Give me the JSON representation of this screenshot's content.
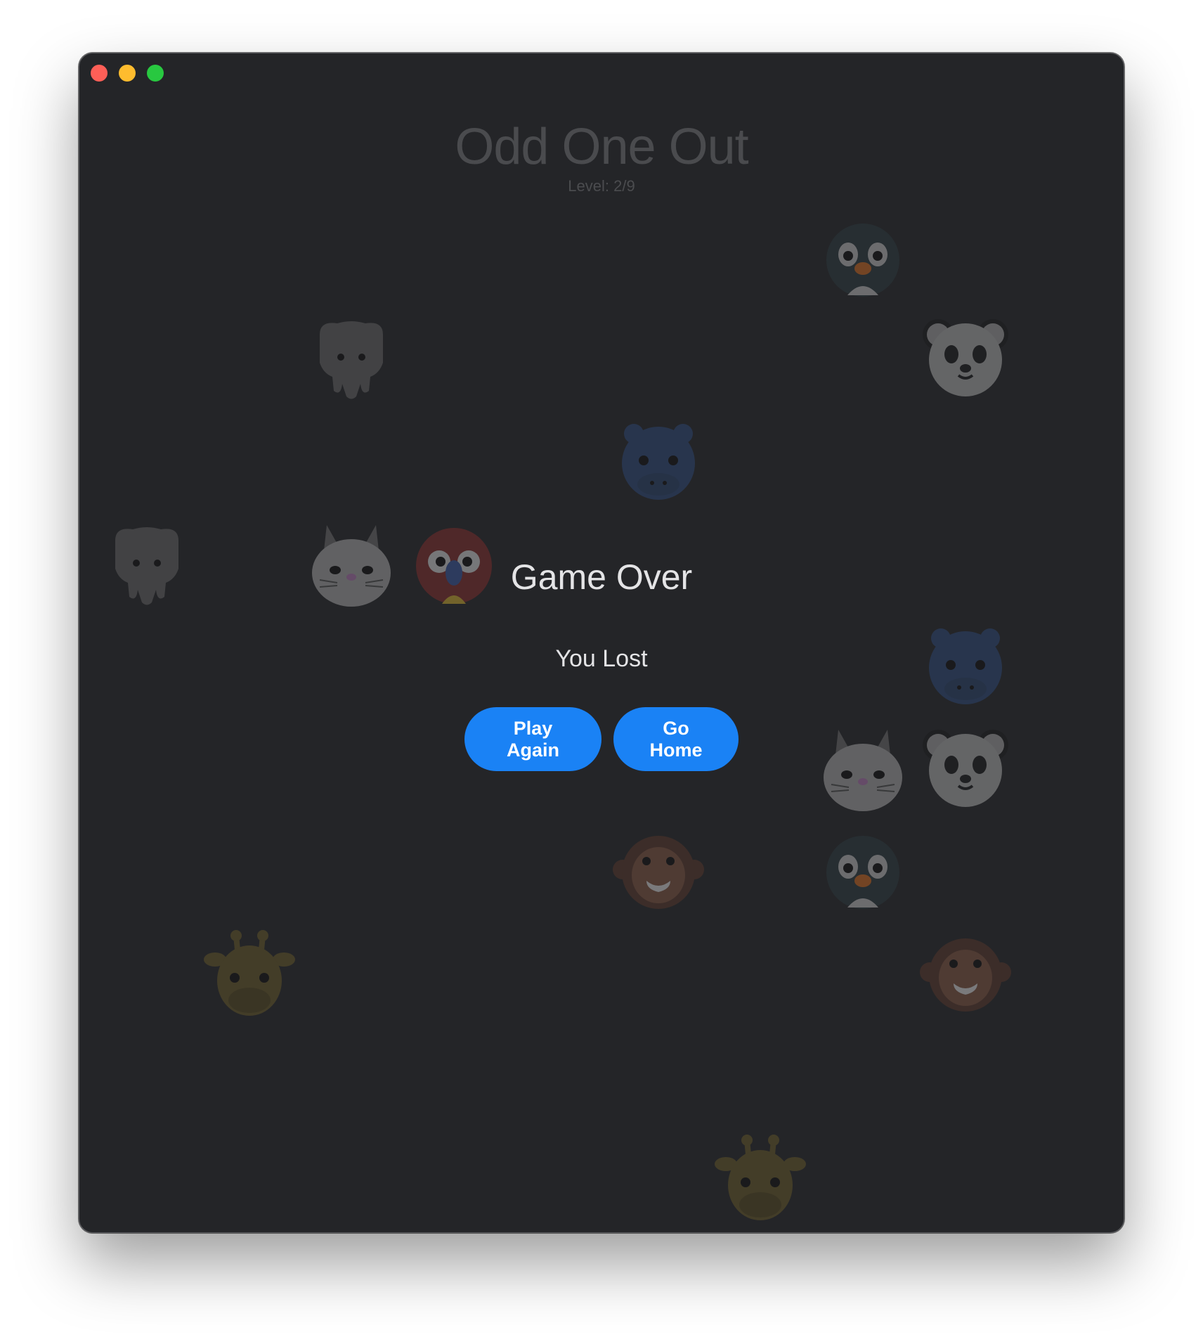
{
  "window": {
    "controls": [
      "close",
      "minimize",
      "maximize"
    ]
  },
  "header": {
    "title": "Odd One Out",
    "level_label": "Level:",
    "level_current": "2",
    "level_total": "9",
    "level_text": "Level: 2/9"
  },
  "overlay": {
    "heading": "Game Over",
    "message": "You Lost",
    "play_again_label": "Play Again",
    "go_home_label": "Go Home"
  },
  "animals": [
    {
      "kind": "penguin",
      "icon": "penguin-icon",
      "color": "#2d3b40"
    },
    {
      "kind": "elephant",
      "icon": "elephant-icon",
      "color": "#6c6c6c"
    },
    {
      "kind": "panda",
      "icon": "panda-icon",
      "color": "#707070"
    },
    {
      "kind": "hippo",
      "icon": "hippo-icon",
      "color": "#2f4d80"
    },
    {
      "kind": "elephant",
      "icon": "elephant-icon",
      "color": "#6c6c6c"
    },
    {
      "kind": "rabbit",
      "icon": "rabbit-icon",
      "color": "#737373"
    },
    {
      "kind": "parrot",
      "icon": "parrot-icon",
      "color": "#8a2d2c"
    },
    {
      "kind": "hippo",
      "icon": "hippo-icon",
      "color": "#2f4d80"
    },
    {
      "kind": "rabbit",
      "icon": "rabbit-icon",
      "color": "#737373"
    },
    {
      "kind": "panda",
      "icon": "panda-icon",
      "color": "#707070"
    },
    {
      "kind": "monkey",
      "icon": "monkey-icon",
      "color": "#5e3a2b"
    },
    {
      "kind": "penguin",
      "icon": "penguin-icon",
      "color": "#2d3b40"
    },
    {
      "kind": "giraffe",
      "icon": "giraffe-icon",
      "color": "#6e5e28"
    },
    {
      "kind": "monkey",
      "icon": "monkey-icon",
      "color": "#5e3a2b"
    },
    {
      "kind": "giraffe",
      "icon": "giraffe-icon",
      "color": "#6e5e28"
    }
  ],
  "colors": {
    "window_bg": "#242528",
    "button_bg": "#1a82f5",
    "button_text": "#ffffff",
    "overlay_text": "#e4e4e6",
    "title_text": "#4a4b4e"
  }
}
